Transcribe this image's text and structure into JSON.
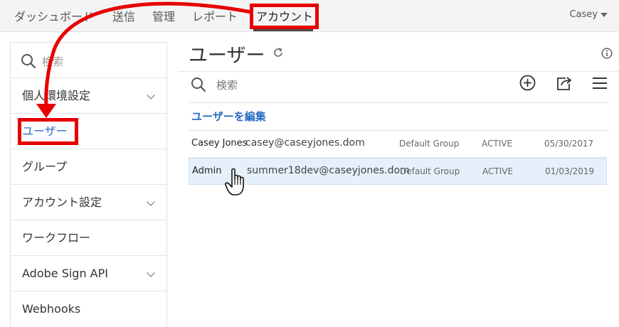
{
  "topnav": {
    "items": [
      {
        "label": "ダッシュボード"
      },
      {
        "label": "送信"
      },
      {
        "label": "管理"
      },
      {
        "label": "レポート"
      },
      {
        "label": "アカウント"
      }
    ],
    "active_index": 4,
    "user_name": "Casey"
  },
  "sidebar": {
    "search_placeholder": "検索",
    "items": [
      {
        "label": "個人環境設定",
        "expandable": true
      },
      {
        "label": "ユーザー",
        "expandable": false,
        "selected": true
      },
      {
        "label": "グループ",
        "expandable": false
      },
      {
        "label": "アカウント設定",
        "expandable": true
      },
      {
        "label": "ワークフロー",
        "expandable": false
      },
      {
        "label": "Adobe Sign API",
        "expandable": true
      },
      {
        "label": "Webhooks",
        "expandable": false
      }
    ]
  },
  "main": {
    "title": "ユーザー",
    "search_placeholder": "検索",
    "edit_users_label": "ユーザーを編集",
    "users": [
      {
        "name": "Casey Jones",
        "email": "casey@caseyjones.dom",
        "group": "Default Group",
        "status": "ACTIVE",
        "date": "05/30/2017",
        "selected": false
      },
      {
        "name": "Admin",
        "email": "summer18dev@caseyjones.dom",
        "group": "Default Group",
        "status": "ACTIVE",
        "date": "01/03/2019",
        "selected": true
      }
    ]
  },
  "icons": {
    "search": "search-icon",
    "refresh": "refresh-icon",
    "info": "info-icon",
    "add": "add-circle-icon",
    "export": "export-icon",
    "menu": "hamburger-menu-icon",
    "chevron": "chevron-down-icon",
    "cursor": "hand-cursor-icon"
  },
  "colors": {
    "accent_blue": "#2b6bc4",
    "annotation_red": "#e80000",
    "selected_row": "#e6f0fa",
    "topnav_bg": "#f4f4f4"
  }
}
